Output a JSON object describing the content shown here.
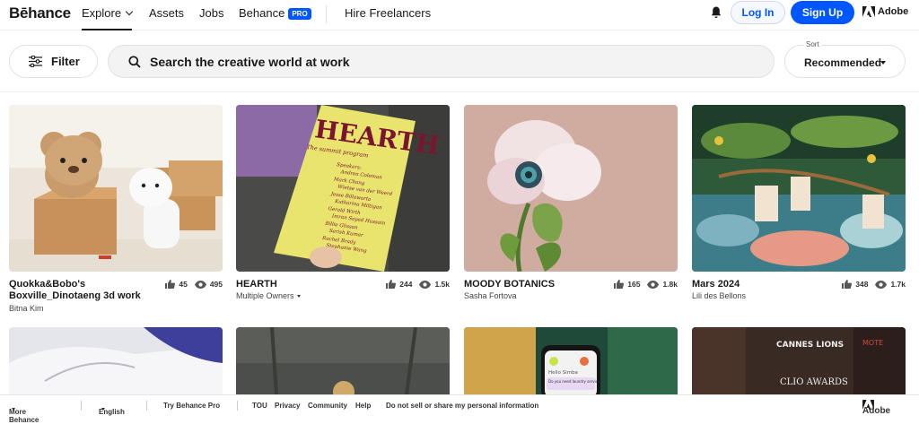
{
  "nav": {
    "logo": "Bēhance",
    "explore": "Explore",
    "assets": "Assets",
    "jobs": "Jobs",
    "behance": "Behance",
    "pro_badge": "PRO",
    "hire": "Hire Freelancers",
    "login": "Log In",
    "signup": "Sign Up",
    "adobe": "Adobe"
  },
  "toolbar": {
    "filter": "Filter",
    "search_text": "Search the creative world at work",
    "sort_label": "Sort",
    "sort_value": "Recommended"
  },
  "projects": [
    {
      "title": "Quokka&Bobo's Boxville_Dinotaeng 3d work",
      "owner": "Bitna Kim",
      "likes": "45",
      "views": "495"
    },
    {
      "title": "HEARTH",
      "owner": "Multiple Owners",
      "likes": "244",
      "views": "1.5k"
    },
    {
      "title": "MOODY BOTANICS",
      "owner": "Sasha Fortova",
      "likes": "165",
      "views": "1.8k"
    },
    {
      "title": "Mars 2024",
      "owner": "Lili des Bellons",
      "likes": "348",
      "views": "1.7k"
    }
  ],
  "thumb_text": {
    "hearth_title": "HEARTH",
    "hearth_sub": "The summit program",
    "hearth_lines": [
      "Speakers:",
      "Andrea Coleman",
      "Mark Chang",
      "Wietse van der Weerd",
      "Jesse Billaworta",
      "Katharina Miltigan",
      "Gerald Wirth",
      "Imran Sayed Hussain",
      "Billie Glisson",
      "Serish Kumar",
      "Rachel Brady",
      "Stephanie Wang"
    ],
    "phone_hello": "Hello Simba",
    "phone_msg": "Do you need laundry services",
    "cannes": "CANNES LIONS",
    "clio": "CLIO AWARDS",
    "motel": "MOTE"
  },
  "footer": {
    "more": "More Behance",
    "language": "English",
    "try_pro": "Try Behance Pro",
    "tou": "TOU",
    "privacy": "Privacy",
    "community": "Community",
    "help": "Help",
    "do_not_sell": "Do not sell or share my personal information",
    "adobe": "Adobe"
  }
}
